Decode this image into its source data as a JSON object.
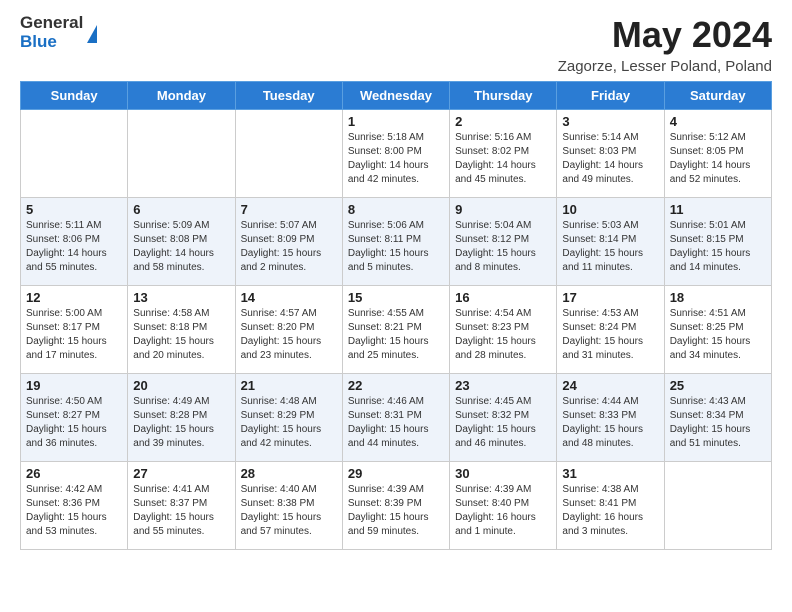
{
  "header": {
    "logo_general": "General",
    "logo_blue": "Blue",
    "title": "May 2024",
    "location": "Zagorze, Lesser Poland, Poland"
  },
  "weekdays": [
    "Sunday",
    "Monday",
    "Tuesday",
    "Wednesday",
    "Thursday",
    "Friday",
    "Saturday"
  ],
  "weeks": [
    [
      {
        "day": "",
        "info": ""
      },
      {
        "day": "",
        "info": ""
      },
      {
        "day": "",
        "info": ""
      },
      {
        "day": "1",
        "info": "Sunrise: 5:18 AM\nSunset: 8:00 PM\nDaylight: 14 hours\nand 42 minutes."
      },
      {
        "day": "2",
        "info": "Sunrise: 5:16 AM\nSunset: 8:02 PM\nDaylight: 14 hours\nand 45 minutes."
      },
      {
        "day": "3",
        "info": "Sunrise: 5:14 AM\nSunset: 8:03 PM\nDaylight: 14 hours\nand 49 minutes."
      },
      {
        "day": "4",
        "info": "Sunrise: 5:12 AM\nSunset: 8:05 PM\nDaylight: 14 hours\nand 52 minutes."
      }
    ],
    [
      {
        "day": "5",
        "info": "Sunrise: 5:11 AM\nSunset: 8:06 PM\nDaylight: 14 hours\nand 55 minutes."
      },
      {
        "day": "6",
        "info": "Sunrise: 5:09 AM\nSunset: 8:08 PM\nDaylight: 14 hours\nand 58 minutes."
      },
      {
        "day": "7",
        "info": "Sunrise: 5:07 AM\nSunset: 8:09 PM\nDaylight: 15 hours\nand 2 minutes."
      },
      {
        "day": "8",
        "info": "Sunrise: 5:06 AM\nSunset: 8:11 PM\nDaylight: 15 hours\nand 5 minutes."
      },
      {
        "day": "9",
        "info": "Sunrise: 5:04 AM\nSunset: 8:12 PM\nDaylight: 15 hours\nand 8 minutes."
      },
      {
        "day": "10",
        "info": "Sunrise: 5:03 AM\nSunset: 8:14 PM\nDaylight: 15 hours\nand 11 minutes."
      },
      {
        "day": "11",
        "info": "Sunrise: 5:01 AM\nSunset: 8:15 PM\nDaylight: 15 hours\nand 14 minutes."
      }
    ],
    [
      {
        "day": "12",
        "info": "Sunrise: 5:00 AM\nSunset: 8:17 PM\nDaylight: 15 hours\nand 17 minutes."
      },
      {
        "day": "13",
        "info": "Sunrise: 4:58 AM\nSunset: 8:18 PM\nDaylight: 15 hours\nand 20 minutes."
      },
      {
        "day": "14",
        "info": "Sunrise: 4:57 AM\nSunset: 8:20 PM\nDaylight: 15 hours\nand 23 minutes."
      },
      {
        "day": "15",
        "info": "Sunrise: 4:55 AM\nSunset: 8:21 PM\nDaylight: 15 hours\nand 25 minutes."
      },
      {
        "day": "16",
        "info": "Sunrise: 4:54 AM\nSunset: 8:23 PM\nDaylight: 15 hours\nand 28 minutes."
      },
      {
        "day": "17",
        "info": "Sunrise: 4:53 AM\nSunset: 8:24 PM\nDaylight: 15 hours\nand 31 minutes."
      },
      {
        "day": "18",
        "info": "Sunrise: 4:51 AM\nSunset: 8:25 PM\nDaylight: 15 hours\nand 34 minutes."
      }
    ],
    [
      {
        "day": "19",
        "info": "Sunrise: 4:50 AM\nSunset: 8:27 PM\nDaylight: 15 hours\nand 36 minutes."
      },
      {
        "day": "20",
        "info": "Sunrise: 4:49 AM\nSunset: 8:28 PM\nDaylight: 15 hours\nand 39 minutes."
      },
      {
        "day": "21",
        "info": "Sunrise: 4:48 AM\nSunset: 8:29 PM\nDaylight: 15 hours\nand 42 minutes."
      },
      {
        "day": "22",
        "info": "Sunrise: 4:46 AM\nSunset: 8:31 PM\nDaylight: 15 hours\nand 44 minutes."
      },
      {
        "day": "23",
        "info": "Sunrise: 4:45 AM\nSunset: 8:32 PM\nDaylight: 15 hours\nand 46 minutes."
      },
      {
        "day": "24",
        "info": "Sunrise: 4:44 AM\nSunset: 8:33 PM\nDaylight: 15 hours\nand 48 minutes."
      },
      {
        "day": "25",
        "info": "Sunrise: 4:43 AM\nSunset: 8:34 PM\nDaylight: 15 hours\nand 51 minutes."
      }
    ],
    [
      {
        "day": "26",
        "info": "Sunrise: 4:42 AM\nSunset: 8:36 PM\nDaylight: 15 hours\nand 53 minutes."
      },
      {
        "day": "27",
        "info": "Sunrise: 4:41 AM\nSunset: 8:37 PM\nDaylight: 15 hours\nand 55 minutes."
      },
      {
        "day": "28",
        "info": "Sunrise: 4:40 AM\nSunset: 8:38 PM\nDaylight: 15 hours\nand 57 minutes."
      },
      {
        "day": "29",
        "info": "Sunrise: 4:39 AM\nSunset: 8:39 PM\nDaylight: 15 hours\nand 59 minutes."
      },
      {
        "day": "30",
        "info": "Sunrise: 4:39 AM\nSunset: 8:40 PM\nDaylight: 16 hours\nand 1 minute."
      },
      {
        "day": "31",
        "info": "Sunrise: 4:38 AM\nSunset: 8:41 PM\nDaylight: 16 hours\nand 3 minutes."
      },
      {
        "day": "",
        "info": ""
      }
    ]
  ]
}
